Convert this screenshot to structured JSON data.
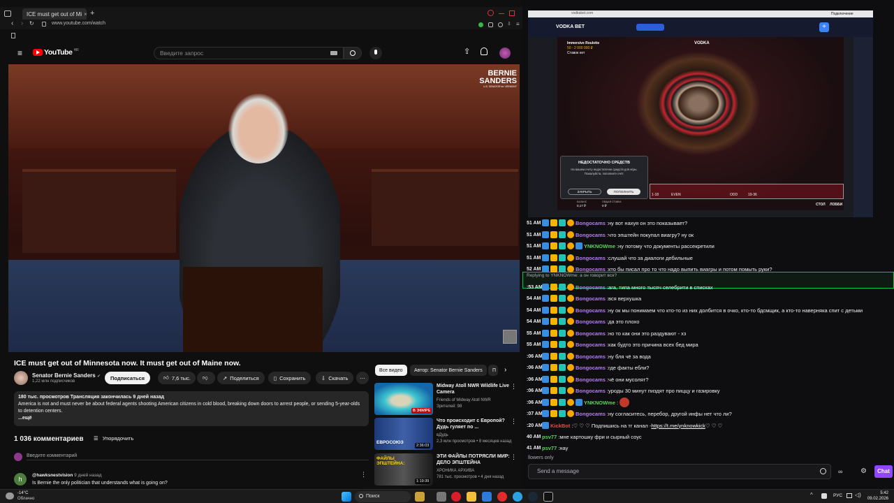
{
  "browser": {
    "tab_title": "ICE must get out of Mi",
    "url": "www.youtube.com/watch"
  },
  "youtube": {
    "logo": "YouTube",
    "logo_region": "HR",
    "search_placeholder": "Введите запрос",
    "video_overlay_name": "BERNIE SANDERS",
    "video_overlay_sub": "U.S. SENATOR for VERMONT",
    "video_title": "ICE must get out of Minnesota now. It must get out of Maine now.",
    "channel_name": "Senator Bernie Sanders",
    "subscribers": "1,22 млн подписчиков",
    "subscribe_label": "Подписаться",
    "likes": "7,6 тыс.",
    "share_label": "Поделиться",
    "save_label": "Сохранить",
    "download_label": "Скачать",
    "description_meta": "180 тыс. просмотров  Трансляция закончилась 9 дней назад",
    "description_text": "America is not and must never be about federal agents shooting American citizens in cold blood, breaking down doors to arrest people, or sending 5-year-olds to detention centers.",
    "description_more": "...ещё",
    "comments_count": "1 036 комментариев",
    "sort_label": "Упорядочить",
    "comment_placeholder": "Введите комментарий",
    "first_comment": {
      "avatar": "h",
      "author": "@hawksnestvision",
      "time": "9 дней назад",
      "text": "Is Bernie the only politician that understands what is going on?"
    },
    "chips": [
      "Все видео",
      "Автор: Senator Bernie Sanders",
      "П"
    ],
    "recommendations": [
      {
        "title": "Midway Atoll NWR Wildlife Live Camera",
        "channel": "Friends of Midway Atoll NWR",
        "meta": "Зрителей: 98",
        "badge": "В ЭФИРЕ"
      },
      {
        "title": "Что происходит с Европой? Дудь гуляет по ...",
        "channel": "вДудь",
        "meta": "2,3 млн просмотров • 8 месяцев назад",
        "badge": "2:36:03",
        "thumb_text": "ЕВРОСОЮЗ"
      },
      {
        "title": "ЭТИ ФАЙЛЫ ПОТРЯСЛИ МИР: ДЕЛО ЭПШТЕЙНА",
        "channel": "ХРОНИКА АРХИВА",
        "meta": "781 тыс. просмотров • 4 дня назад",
        "badge": "1:19:39",
        "thumb_text": "ФАЙЛЫ ЭПШТЕЙНА:"
      }
    ]
  },
  "casino": {
    "logo": "VODKA BET",
    "url": "vodkabet.com",
    "game_title": "Immersive Roulette",
    "game_limits": "50 - 2 000 000 ₽",
    "game_sub": "Ставок нет",
    "table_logo": "VODKA",
    "dialog_title": "НЕДОСТАТОЧНО СРЕДСТВ",
    "dialog_text": "На вашем счету недостаточно средств для игры. Пожалуйста, пополните счёт.",
    "dialog_close": "ЗАКРЫТЬ",
    "dialog_deposit": "ПОПОЛНИТЬ",
    "balance_label": "БАЛАНС",
    "balance_value": "0,17 ₽",
    "total_bet_label": "ОБЩАЯ СТАВКА",
    "total_bet_value": "0 ₽",
    "bet_labels": [
      "1-18",
      "EVEN",
      "ODD",
      "19-36"
    ],
    "stop_label": "СТОЛ",
    "lobby_label": "ЛОББИ",
    "webcam_label": "Подключение"
  },
  "chat": {
    "messages": [
      {
        "time": "51 AM",
        "user": "Bongocams",
        "color": "#b57cf2",
        "text": "ну вот нахуя он это показывает?",
        "badges": 4
      },
      {
        "time": "51 AM",
        "user": "Bongocams",
        "color": "#b57cf2",
        "text": "что эпштейн покупал виагру? ну ок",
        "badges": 4
      },
      {
        "time": "51 AM",
        "user": "YNKNOWme",
        "color": "#58d558",
        "text": "ну потому что документы рассекретили",
        "badges": 5
      },
      {
        "time": "51 AM",
        "user": "Bongocams",
        "color": "#b57cf2",
        "text": "слушай что за диалоги дебильные",
        "badges": 4
      },
      {
        "time": "52 AM",
        "user": "Bongocams",
        "color": "#b57cf2",
        "text": "кто бы писал про то что надо выпить виагры и потом помыть руки?",
        "badges": 4
      },
      {
        "time": ":53 AM",
        "user": "Bongocams",
        "color": "#b57cf2",
        "text": "ага, типа много тысяч селебрити в списках",
        "badges": 4,
        "reply": "Replying to YNKNOWme: а он говорит вся?"
      },
      {
        "time": "54 AM",
        "user": "Bongocams",
        "color": "#b57cf2",
        "text": "вся верхушка",
        "badges": 4
      },
      {
        "time": "54 AM",
        "user": "Bongocams",
        "color": "#b57cf2",
        "text": "ну ок мы понимаем что кто-то из них долбится в очко, кто-то бдсмщик, а кто-то наверняка спит с детьми",
        "badges": 4
      },
      {
        "time": "54 AM",
        "user": "Bongocams",
        "color": "#b57cf2",
        "text": "да это плохо",
        "badges": 4
      },
      {
        "time": "55 AM",
        "user": "Bongocams",
        "color": "#b57cf2",
        "text": "но то как они это раздувают - хз",
        "badges": 4
      },
      {
        "time": "55 AM",
        "user": "Bongocams",
        "color": "#b57cf2",
        "text": "как будто это причина всех бед мира",
        "badges": 4
      },
      {
        "time": ":06 AM",
        "user": "Bongocams",
        "color": "#b57cf2",
        "text": "ну бля чё за вода",
        "badges": 4
      },
      {
        "time": ":06 AM",
        "user": "Bongocams",
        "color": "#b57cf2",
        "text": "где факты ебли?",
        "badges": 4
      },
      {
        "time": ":06 AM",
        "user": "Bongocams",
        "color": "#b57cf2",
        "text": "чё они мусолят?",
        "badges": 4
      },
      {
        "time": ":06 AM",
        "user": "Bongocams",
        "color": "#b57cf2",
        "text": "уроды 30 минут пиздят про пиццу и газировку",
        "badges": 4
      },
      {
        "time": ":06 AM",
        "user": "YNKNOWme",
        "color": "#58d558",
        "text": "",
        "badges": 5
      },
      {
        "time": ":07 AM",
        "user": "Bongocams",
        "color": "#b57cf2",
        "text": "ну согласитесь, перебор, другой инфы нет что ли?",
        "badges": 4
      },
      {
        "time": ":20 AM",
        "user": "KickBot",
        "color": "#e84a4a",
        "text": "♡ ♡ ♡ Подпишись на тг канал - ",
        "link": "https://t.me/ynknowkick",
        "tail": " ♡ ♡ ♡",
        "badges": 1
      },
      {
        "time": "40 AM",
        "user": "psv77",
        "color": "#58d558",
        "text": "мне картошку фри и сырный соус",
        "badges": 0
      },
      {
        "time": "41 AM",
        "user": "psv77",
        "color": "#58d558",
        "text": "нау",
        "badges": 0
      }
    ],
    "followers_only": "llowers only",
    "input_placeholder": "Send a message",
    "chat_button": "Chat"
  },
  "taskbar": {
    "weather_temp": "-14°C",
    "weather_text": "Облачно",
    "search_label": "Поиск",
    "lang": "РУС",
    "time": "5:42",
    "date": "09.02.2026"
  }
}
